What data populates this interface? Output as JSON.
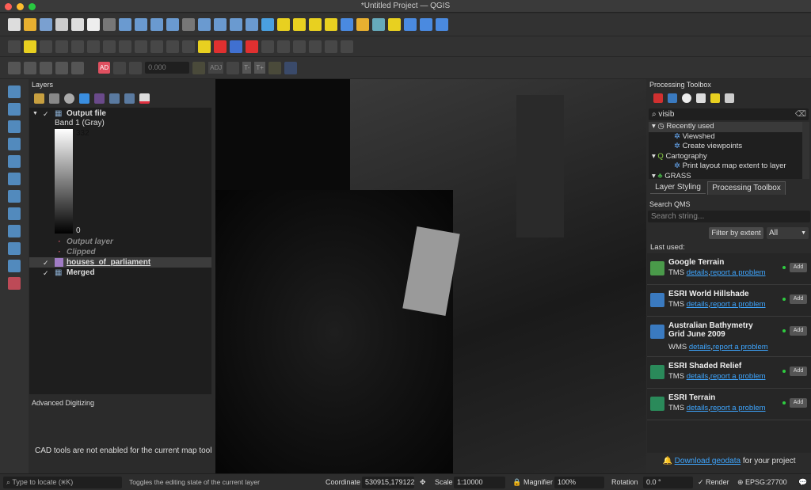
{
  "window": {
    "title": "*Untitled Project — QGIS"
  },
  "layers_panel": {
    "title": "Layers",
    "legend_band": "Band 1 (Gray)",
    "legend_max": "332",
    "legend_min": "0",
    "items": [
      {
        "name": "Output file",
        "checked": true
      },
      {
        "name": "Output layer",
        "checked": false
      },
      {
        "name": "Clipped",
        "checked": false
      },
      {
        "name": "houses_of_parliament",
        "checked": true,
        "color": "#a07cc5"
      },
      {
        "name": "Merged",
        "checked": true
      }
    ]
  },
  "adv_digitizing": {
    "title": "Advanced Digitizing",
    "message": "CAD tools are not enabled for the current map tool"
  },
  "toolbar": {
    "ad_label": "AD",
    "value": "0.000",
    "adj": "ADJ",
    "t_minus": "T-",
    "t_plus": "T+"
  },
  "processing": {
    "title": "Processing Toolbox",
    "search": "visib",
    "tree": [
      {
        "label": "Recently used",
        "level": 0
      },
      {
        "label": "Viewshed",
        "level": 1
      },
      {
        "label": "Create viewpoints",
        "level": 1
      },
      {
        "label": "Cartography",
        "level": 0
      },
      {
        "label": "Print layout map extent to layer",
        "level": 1
      },
      {
        "label": "GRASS",
        "level": 0
      }
    ],
    "tabs": [
      "Layer Styling",
      "Processing Toolbox"
    ],
    "active_tab": "Processing Toolbox"
  },
  "qms": {
    "title": "Search QMS",
    "placeholder": "Search string...",
    "filter_btn": "Filter by extent",
    "filter_select": "All",
    "last_used": "Last used:",
    "items": [
      {
        "name": "Google Terrain",
        "type": "TMS",
        "details": "details",
        "report": "report a problem",
        "add": "Add"
      },
      {
        "name": "ESRI World Hillshade",
        "type": "TMS",
        "details": "details",
        "report": "report a problem",
        "add": "Add"
      },
      {
        "name": "Australian Bathymetry Grid June 2009",
        "type": "WMS",
        "details": "details",
        "report": "report a problem",
        "add": "Add"
      },
      {
        "name": "ESRI Shaded Relief",
        "type": "TMS",
        "details": "details",
        "report": "report a problem",
        "add": "Add"
      },
      {
        "name": "ESRI Terrain",
        "type": "TMS",
        "details": "details",
        "report": "report a problem",
        "add": "Add"
      }
    ],
    "footer_link": "Download geodata",
    "footer_text": " for your project"
  },
  "status": {
    "locate_placeholder": "Type to locate (⌘K)",
    "hint": "Toggles the editing state of the current layer",
    "coordinate_label": "Coordinate",
    "coordinate": "530915,179122",
    "scale_label": "Scale",
    "scale": "1:10000",
    "magnifier_label": "Magnifier",
    "magnifier": "100%",
    "rotation_label": "Rotation",
    "rotation": "0.0 °",
    "render_label": "Render",
    "render_checked": true,
    "crs": "EPSG:27700"
  }
}
